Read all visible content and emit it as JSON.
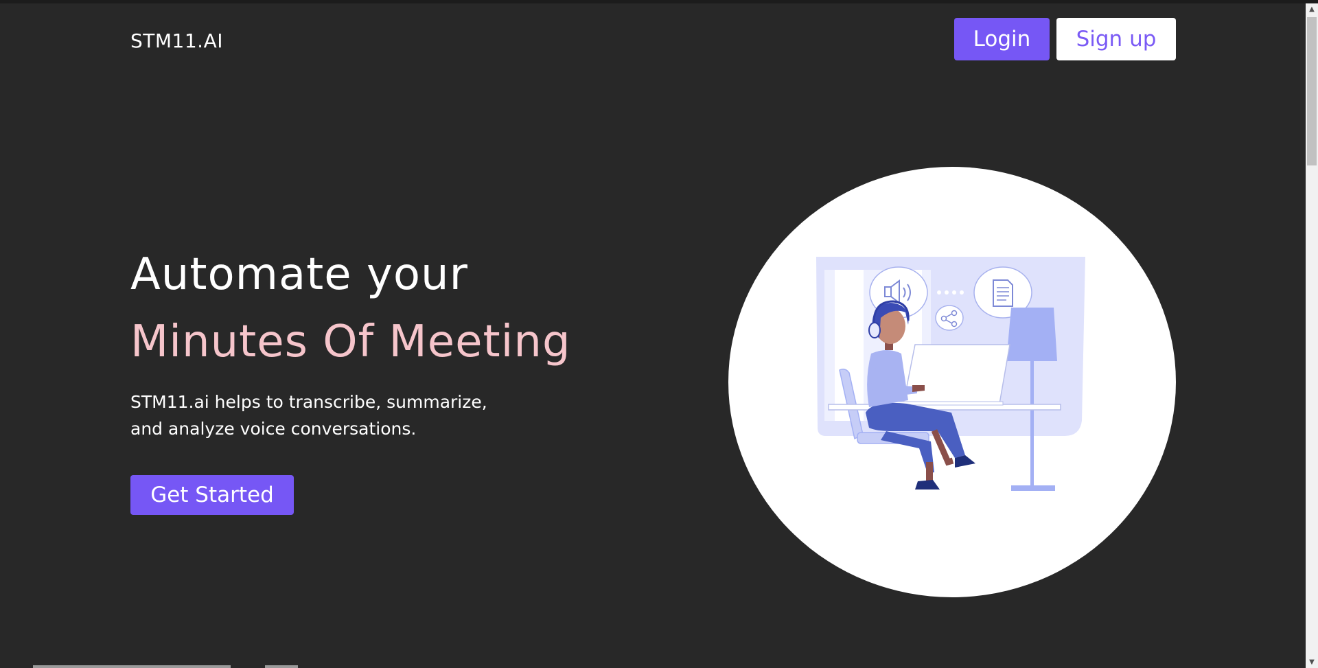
{
  "header": {
    "brand": "STM11.AI",
    "login_label": "Login",
    "signup_label": "Sign up"
  },
  "hero": {
    "title_line1": "Automate your",
    "title_line2": "Minutes Of Meeting",
    "description_line1": "STM11.ai helps to transcribe, summarize,",
    "description_line2": "and analyze voice conversations.",
    "cta_label": "Get Started"
  },
  "illustration": {
    "icons": [
      "speaker-icon",
      "document-icon",
      "share-icon",
      "headphones-icon"
    ]
  },
  "colors": {
    "background": "#282828",
    "accent": "#7657f5",
    "highlight_text": "#f6c5cb",
    "illustration_blue": "#4a5fc1",
    "illustration_light": "#dcdffb"
  }
}
